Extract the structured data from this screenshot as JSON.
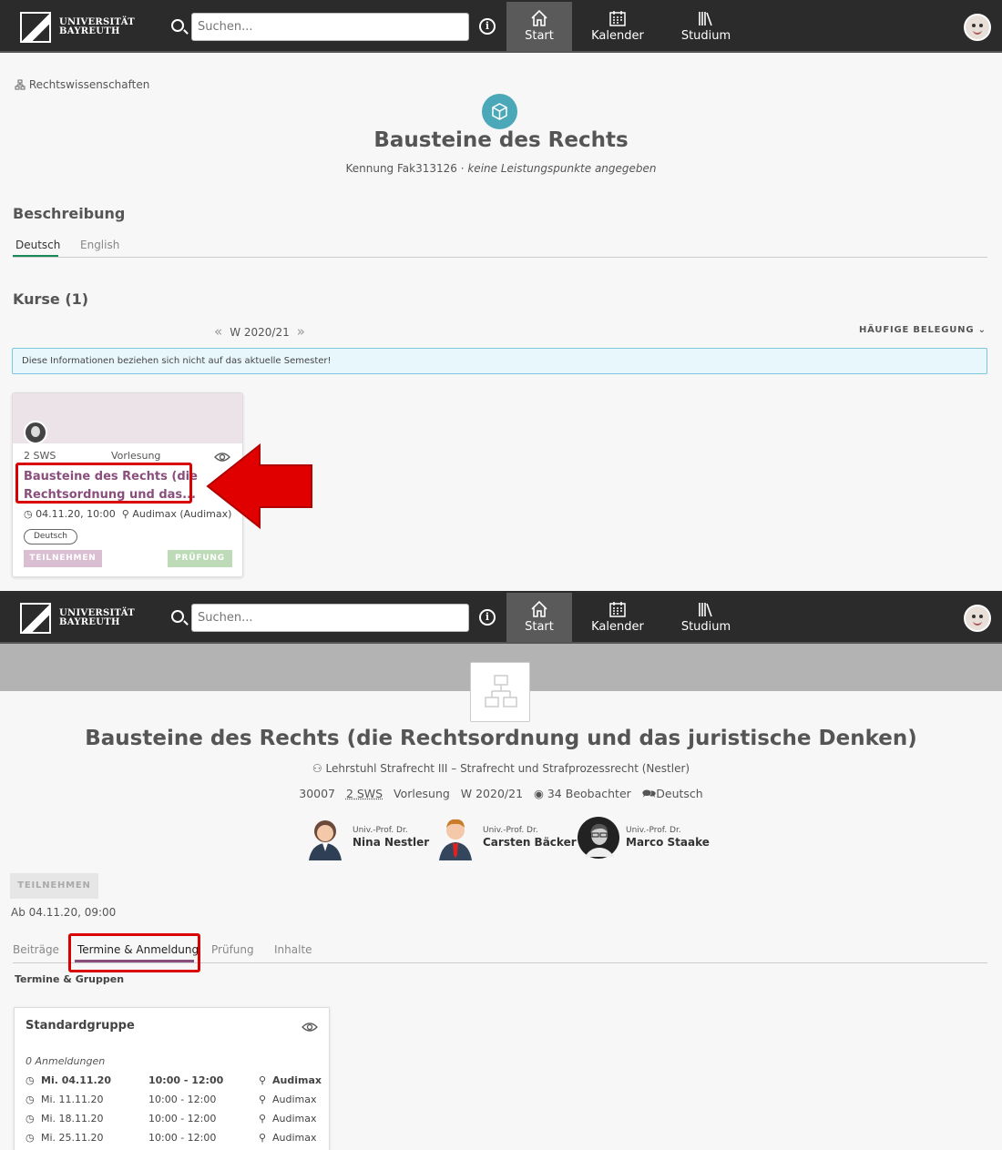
{
  "header": {
    "logo_line1": "UNIVERSITÄT",
    "logo_line2": "BAYREUTH",
    "search_placeholder": "Suchen...",
    "nav": [
      "Start",
      "Kalender",
      "Studium"
    ]
  },
  "module": {
    "breadcrumb": "Rechtswissenschaften",
    "title": "Bausteine des Rechts",
    "id_text": "Kennung Fak313126 · ",
    "credits_text": "keine Leistungspunkte angegeben",
    "description_heading": "Beschreibung",
    "lang_tabs": [
      "Deutsch",
      "English"
    ],
    "courses_heading": "Kurse (1)",
    "semester": "W 2020/21",
    "sort_label": "HÄUFIGE BELEGUNG",
    "notice": "Diese Informationen beziehen sich nicht auf das aktuelle Semester!",
    "card": {
      "sws": "2 SWS",
      "type": "Vorlesung",
      "title_line1": "Bausteine des Rechts (die",
      "title_line2": "Rechtsordnung und das...",
      "time": "04.11.20, 10:00",
      "location": "Audimax (Audimax)",
      "lang_badge": "Deutsch",
      "btn_join": "TEILNEHMEN",
      "btn_exam": "PRÜFUNG"
    }
  },
  "course": {
    "title": "Bausteine des Rechts (die Rechtsordnung und das juristische Denken)",
    "chair": "Lehrstuhl Strafrecht III – Strafrecht und Strafprozessrecht (Nestler)",
    "number": "30007",
    "sws": "2 SWS",
    "type": "Vorlesung",
    "semester": "W 2020/21",
    "observers": "34 Beobachter",
    "language": "Deutsch",
    "professors": [
      {
        "title": "Univ.-Prof. Dr.",
        "name": "Nina Nestler"
      },
      {
        "title": "Univ.-Prof. Dr.",
        "name": "Carsten Bäcker"
      },
      {
        "title": "Univ.-Prof. Dr.",
        "name": "Marco Staake"
      }
    ],
    "join_btn": "TEILNEHMEN",
    "from_text": "Ab 04.11.20, 09:00",
    "tabs": [
      "Beiträge",
      "Termine & Anmeldung",
      "Prüfung",
      "Inhalte"
    ],
    "section_heading": "Termine & Gruppen",
    "group": {
      "name": "Standardgruppe",
      "registrations": "0 Anmeldungen",
      "dates": [
        {
          "date": "Mi. 04.11.20",
          "time": "10:00 - 12:00",
          "room": "Audimax"
        },
        {
          "date": "Mi. 11.11.20",
          "time": "10:00 - 12:00",
          "room": "Audimax"
        },
        {
          "date": "Mi. 18.11.20",
          "time": "10:00 - 12:00",
          "room": "Audimax"
        },
        {
          "date": "Mi. 25.11.20",
          "time": "10:00 - 12:00",
          "room": "Audimax"
        }
      ]
    }
  },
  "colors": {
    "accent": "#1a8a5a",
    "brand_purple": "#8a4e7c",
    "highlight_red": "#d80000",
    "teal": "#4ba8b8"
  }
}
